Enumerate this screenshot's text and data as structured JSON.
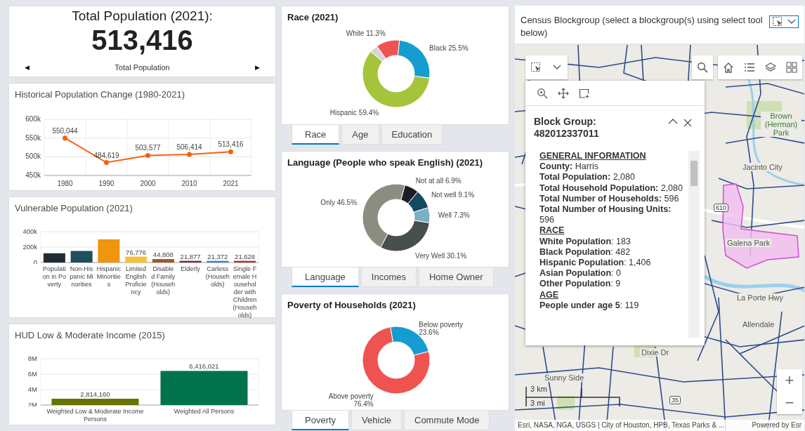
{
  "total_population": {
    "title": "Total Population (2021):",
    "value": "513,416",
    "label": "Total Population",
    "prev": "◀",
    "next": "▶"
  },
  "historical": {
    "title": "Historical Population Change (1980-2021)",
    "chart_data": {
      "type": "line",
      "categories": [
        "1980",
        "1990",
        "2000",
        "2010",
        "2021"
      ],
      "series": [
        {
          "color": "#f5620f",
          "marker": true,
          "values": [
            550044,
            484619,
            503577,
            506414,
            513416
          ]
        }
      ],
      "ylim": [
        450000,
        600000
      ],
      "yticks": [
        {
          "value": 450000,
          "label": "450k"
        },
        {
          "value": 500000,
          "label": "500k"
        },
        {
          "value": 550000,
          "label": "550k"
        },
        {
          "value": 600000,
          "label": "600k"
        }
      ],
      "value_labels": [
        "550,044",
        "484,619",
        "503,577",
        "506,414",
        "513,416"
      ]
    }
  },
  "vulnerable": {
    "title": "Vulnerable Population (2021)",
    "chart_data": {
      "type": "bar",
      "categories": [
        "Population in Poverty",
        "Non-Hispanic Minorities",
        "Hispanic Minorities",
        "Limited English Proficiency",
        "Disabled Family (Households)",
        "Elderly",
        "Carless (Households)",
        "Single Female Householder with Children (Households)"
      ],
      "series": [
        {
          "values": [
            120000,
            150000,
            300000,
            76776,
            44808,
            21877,
            21372,
            21628
          ]
        }
      ],
      "colors": [
        "#1f2c35",
        "#1d4f5c",
        "#f0950f",
        "#f9c23c",
        "#a0562e",
        "#7b2d2d",
        "#3b7fd6",
        "#b52b2b"
      ],
      "ylim": [
        0,
        400000
      ],
      "yticks": [
        {
          "value": 0,
          "label": "0"
        },
        {
          "value": 200000,
          "label": "200k"
        },
        {
          "value": 400000,
          "label": "400k"
        }
      ],
      "value_labels": [
        null,
        null,
        null,
        "76,776",
        "44,808",
        "21,877",
        "21,372",
        "21,628"
      ]
    }
  },
  "hud": {
    "title": "HUD Low & Moderate Income (2015)",
    "chart_data": {
      "type": "bar",
      "categories": [
        "Weighted Low & Moderate Income Persons",
        "Weighted All Persons"
      ],
      "series": [
        {
          "values": [
            2814160,
            6416021
          ]
        }
      ],
      "colors": [
        "#667300",
        "#00734c"
      ],
      "ylim": [
        2000000,
        8000000
      ],
      "yticks": [
        {
          "value": 2000000,
          "label": "2M"
        },
        {
          "value": 4000000,
          "label": "4M"
        },
        {
          "value": 6000000,
          "label": "6M"
        },
        {
          "value": 8000000,
          "label": "8M"
        }
      ],
      "value_labels": [
        "2,814,160",
        "6,416,021"
      ]
    }
  },
  "race": {
    "title": "Race (2021)",
    "chart_data": {
      "type": "donut",
      "values": [
        11.3,
        25.5,
        59.4,
        3.8
      ],
      "colors": [
        "#ef5350",
        "#159cd0",
        "#a6c43a",
        "#d6d6d6"
      ],
      "value_labels": [
        "White 11.3%",
        "Black 25.5%",
        "Hispanic 59.4%",
        null
      ]
    },
    "tabs": [
      {
        "label": "Race",
        "selected": true
      },
      {
        "label": "Age",
        "selected": false
      },
      {
        "label": "Education",
        "selected": false
      }
    ]
  },
  "language": {
    "title": "Language (People who speak English) (2021)",
    "chart_data": {
      "type": "donut",
      "values": [
        6.9,
        9.1,
        7.3,
        30.1,
        46.5
      ],
      "colors": [
        "#1c1d24",
        "#124a5e",
        "#78b0c4",
        "#474f4a",
        "#8c8c80"
      ],
      "value_labels": [
        "Not at all 6.9%",
        "Not well 9.1%",
        "Well 7.3%",
        "Very Well 30.1%",
        "Only 46.5%"
      ]
    },
    "tabs": [
      {
        "label": "Language",
        "selected": true
      },
      {
        "label": "Incomes",
        "selected": false
      },
      {
        "label": "Home Owner",
        "selected": false
      }
    ]
  },
  "poverty": {
    "title": "Poverty of Households (2021)",
    "chart_data": {
      "type": "donut",
      "values": [
        23.6,
        76.4
      ],
      "colors": [
        "#159cd0",
        "#ef5350"
      ],
      "value_labels": [
        "Below poverty 23.6%",
        "Above poverty 76.4%"
      ]
    },
    "tabs": [
      {
        "label": "Poverty",
        "selected": true
      },
      {
        "label": "Vehicle",
        "selected": false
      },
      {
        "label": "Commute Mode",
        "selected": false
      }
    ]
  },
  "map": {
    "title": "Census Blockgroup (select a blockgroup(s) using select tool below)",
    "places": [
      {
        "kind": "park",
        "text": "Brown (Herman) Park"
      },
      {
        "kind": "place",
        "text": "Jacinto City"
      },
      {
        "kind": "shield",
        "text": "610"
      },
      {
        "kind": "place",
        "text": "Galena Park"
      },
      {
        "kind": "place",
        "text": "La Porte Hwy"
      },
      {
        "kind": "place",
        "text": "Allendale"
      },
      {
        "kind": "place",
        "text": "Dixie Dr"
      },
      {
        "kind": "shield",
        "text": "35"
      },
      {
        "kind": "place",
        "text": "Sunny Side"
      }
    ],
    "popup": {
      "title": "Block Group: 482012337011",
      "lines": [
        {
          "kind": "heading",
          "text": "GENERAL INFORMATION"
        },
        {
          "kind": "field",
          "text": "**County:** Harris"
        },
        {
          "kind": "field",
          "text": "**Total Population:** 2,080"
        },
        {
          "kind": "field",
          "text": "**Total Household Population:** 2,080"
        },
        {
          "kind": "field",
          "text": "**Total Number of Households:** 596"
        },
        {
          "kind": "field",
          "text": "**Total Number of Housing Units:** 596"
        },
        {
          "kind": "heading",
          "text": "RACE"
        },
        {
          "kind": "field",
          "text": "**White Population**: 183"
        },
        {
          "kind": "field",
          "text": "**Black Population**: 482"
        },
        {
          "kind": "field",
          "text": "**Hispanic Population**: 1,406"
        },
        {
          "kind": "field",
          "text": "**Asian Population**: 0"
        },
        {
          "kind": "field",
          "text": "**Other Population**: 9"
        },
        {
          "kind": "heading",
          "text": "AGE"
        },
        {
          "kind": "field",
          "text": "**People under age 5**: 119"
        }
      ]
    },
    "scale_km": "3 km",
    "scale_mi": "3 mi",
    "zoom_in": "+",
    "zoom_out": "−",
    "attribution": "Esri, NASA, NGA, USGS | City of Houston, HPB, Texas Parks & ...",
    "powered_by": "Powered by Esr"
  }
}
